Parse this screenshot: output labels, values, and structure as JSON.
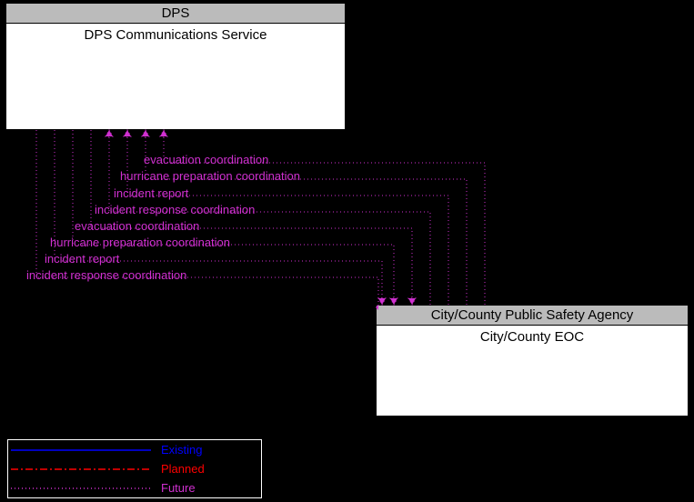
{
  "entities": {
    "dps": {
      "header": "DPS",
      "title": "DPS Communications Service"
    },
    "eoc": {
      "header": "City/County Public Safety Agency",
      "title": "City/County EOC"
    }
  },
  "flows_to_dps": [
    "evacuation coordination",
    "hurricane preparation coordination",
    "incident report",
    "incident response coordination"
  ],
  "flows_to_eoc": [
    "evacuation coordination",
    "hurricane preparation coordination",
    "incident report",
    "incident response coordination"
  ],
  "legend": {
    "existing": "Existing",
    "planned": "Planned",
    "future": "Future"
  },
  "colors": {
    "existing": "#0000ff",
    "planned": "#ff0000",
    "future": "#d030d0"
  }
}
